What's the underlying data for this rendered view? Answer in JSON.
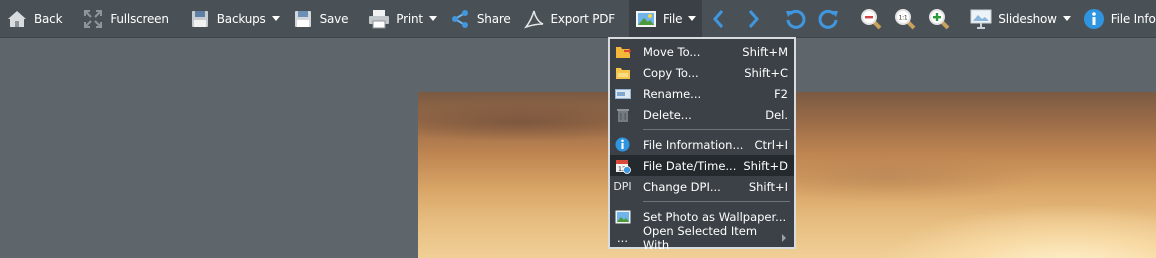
{
  "toolbar": {
    "back": "Back",
    "fullscreen": "Fullscreen",
    "backups": "Backups",
    "save": "Save",
    "print": "Print",
    "share": "Share",
    "export_pdf": "Export PDF",
    "file": "File",
    "slideshow": "Slideshow",
    "file_info": "File Info"
  },
  "file_menu": {
    "items": [
      {
        "label": "Move To...",
        "shortcut": "Shift+M",
        "icon": "folder-move-icon"
      },
      {
        "label": "Copy To...",
        "shortcut": "Shift+C",
        "icon": "folder-copy-icon"
      },
      {
        "label": "Rename...",
        "shortcut": "F2",
        "icon": "rename-icon"
      },
      {
        "label": "Delete...",
        "shortcut": "Del.",
        "icon": "trash-icon"
      },
      {
        "label": "File Information...",
        "shortcut": "Ctrl+I",
        "icon": "info-icon"
      },
      {
        "label": "File Date/Time...",
        "shortcut": "Shift+D",
        "icon": "calendar-icon"
      },
      {
        "label": "Change DPI...",
        "shortcut": "Shift+I",
        "icon_text": "DPI"
      },
      {
        "label": "Set Photo as Wallpaper...",
        "shortcut": "",
        "icon": "wallpaper-icon"
      },
      {
        "label": "Open Selected Item With",
        "shortcut": "",
        "icon_text": "..."
      }
    ]
  },
  "colors": {
    "toolbar_bg": "#4a5156",
    "canvas_bg": "#5f666b",
    "accent_blue": "#2f95e0",
    "menu_bg": "#3b4146",
    "menu_highlight": "#23292d"
  }
}
